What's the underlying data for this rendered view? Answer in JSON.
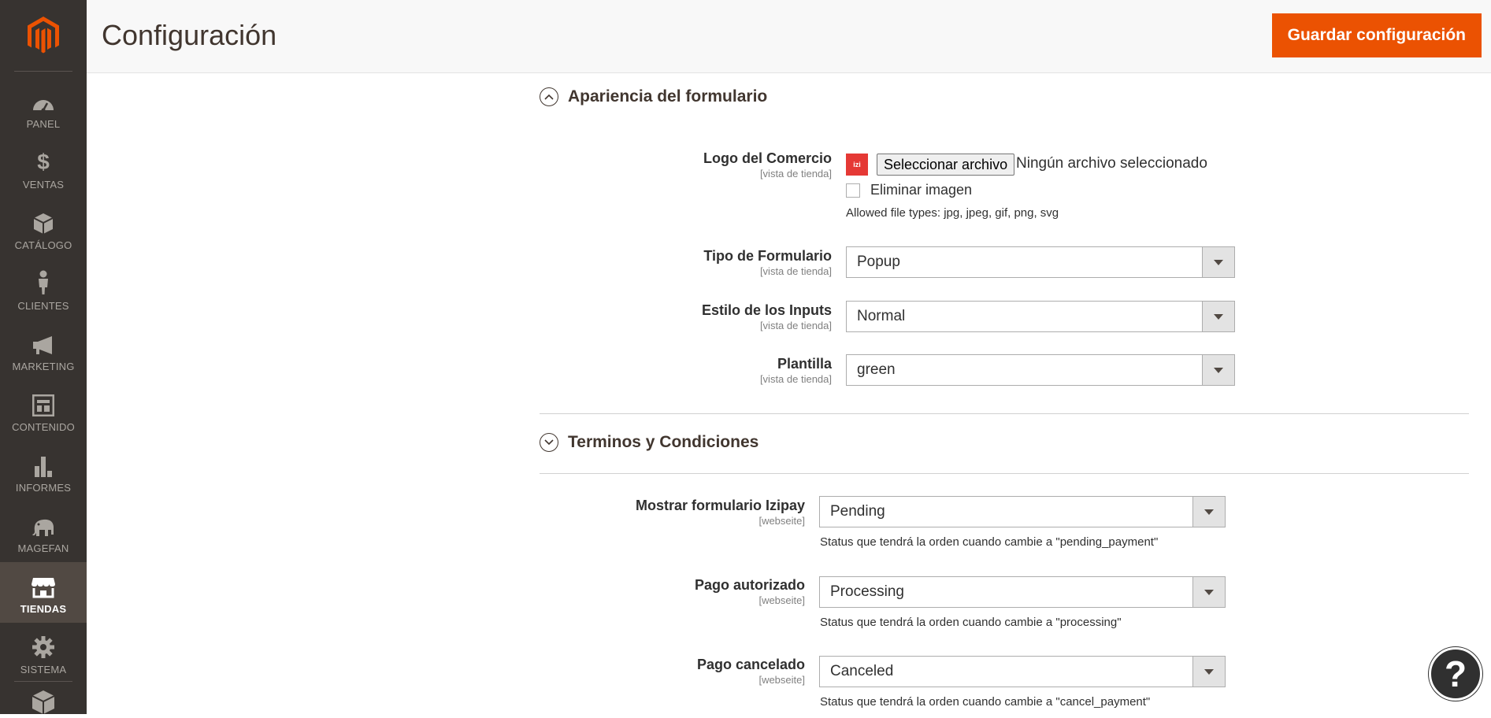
{
  "header": {
    "title": "Configuración",
    "save_label": "Guardar configuración"
  },
  "sidebar": {
    "items": [
      {
        "label": "PANEL",
        "icon": "dashboard-icon"
      },
      {
        "label": "VENTAS",
        "icon": "dollar-icon"
      },
      {
        "label": "CATÁLOGO",
        "icon": "box-icon"
      },
      {
        "label": "CLIENTES",
        "icon": "person-icon"
      },
      {
        "label": "MARKETING",
        "icon": "megaphone-icon"
      },
      {
        "label": "CONTENIDO",
        "icon": "layout-icon"
      },
      {
        "label": "INFORMES",
        "icon": "bar-chart-icon"
      },
      {
        "label": "MAGEFAN",
        "icon": "elephant-icon"
      },
      {
        "label": "TIENDAS",
        "icon": "store-icon",
        "active": true
      },
      {
        "label": "SISTEMA",
        "icon": "gear-icon"
      }
    ]
  },
  "section_appearance": {
    "title": "Apariencia del formulario",
    "logo": {
      "label": "Logo del Comercio",
      "scope": "[vista de tienda]",
      "file_button": "Seleccionar archivo",
      "file_status": "Ningún archivo seleccionado",
      "delete_label": "Eliminar imagen",
      "allowed": "Allowed file types: jpg, jpeg, gif, png, svg"
    },
    "form_type": {
      "label": "Tipo de Formulario",
      "scope": "[vista de tienda]",
      "value": "Popup"
    },
    "input_style": {
      "label": "Estilo de los Inputs",
      "scope": "[vista de tienda]",
      "value": "Normal"
    },
    "template": {
      "label": "Plantilla",
      "scope": "[vista de tienda]",
      "value": "green"
    }
  },
  "section_terms": {
    "title": "Terminos y Condiciones",
    "show_form": {
      "label": "Mostrar formulario Izipay",
      "scope": "[webseite]",
      "value": "Pending",
      "note": "Status que tendrá la orden cuando cambie a \"pending_payment\""
    },
    "authorized": {
      "label": "Pago autorizado",
      "scope": "[webseite]",
      "value": "Processing",
      "note": "Status que tendrá la orden cuando cambie a \"processing\""
    },
    "canceled": {
      "label": "Pago cancelado",
      "scope": "[webseite]",
      "value": "Canceled",
      "note": "Status que tendrá la orden cuando cambie a \"cancel_payment\""
    }
  },
  "help": {
    "label": "?"
  },
  "colors": {
    "accent": "#eb5202",
    "sidebar": "#373330",
    "sidebar_active": "#514943"
  }
}
